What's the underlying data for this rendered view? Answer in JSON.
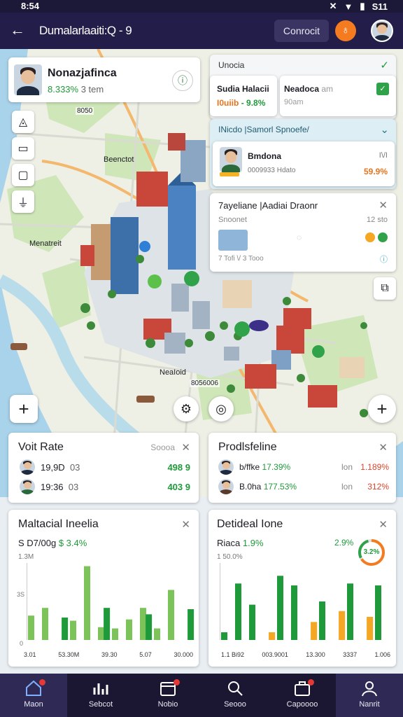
{
  "status": {
    "time": "8:54",
    "battery": "S11"
  },
  "appbar": {
    "title": "Dumalarlaaiti:Q - 9",
    "connect_label": "Conrocit"
  },
  "profile_card": {
    "name": "Nonazjafinca",
    "percent": "8.333%",
    "sub": "3 tem"
  },
  "right_panel": {
    "header": "Unocia",
    "card1": {
      "title": "Sudia Halacii",
      "val1": "I0uiib",
      "val2": "- 9.8%"
    },
    "card2": {
      "title": "Neadoca",
      "sub1": "am",
      "sub2": "90am"
    },
    "section2_header": "INicdo |Samorl Spnoefe/",
    "person": {
      "name": "Bmdona",
      "id": "0009933",
      "extra": "Hdato",
      "right_top": "I\\/I",
      "right_val": "59.9%"
    },
    "detail": {
      "title": "7ayeliane |Aadiai Draonr",
      "sub": "Snoonet",
      "right": "12 sto",
      "row": "7 Tofi \\/ 3 Tooo"
    }
  },
  "map_labels": {
    "l1": "8050",
    "l2": "Beenctot",
    "l3": "Menatreit",
    "l4": "NeaIoid",
    "l5": "8056006"
  },
  "card_rate": {
    "title": "Voit Rate",
    "badge": "Soooa",
    "rows": [
      {
        "v1": "19,9D",
        "v2": "03",
        "v3": "498 9"
      },
      {
        "v1": "19:36",
        "v2": "03",
        "v3": "403 9"
      }
    ]
  },
  "card_profit": {
    "title": "Prodlsfeline",
    "rows": [
      {
        "name": "b/ffke",
        "pct": "17.39%",
        "mid": "lon",
        "val": "1.189%"
      },
      {
        "name": "B.0ha",
        "pct": "177.53%",
        "mid": "lon",
        "val": "312%"
      }
    ]
  },
  "chart_left": {
    "title": "Maltacial Ineelia",
    "subtitle_a": "S D7/00g",
    "subtitle_b": "$ 3.4%",
    "subtitle_c": "1.3M",
    "y_labels": [
      "3S",
      "0"
    ],
    "x_labels": [
      "3.01",
      "53.30M",
      "39.30",
      "5.07",
      "30.000"
    ]
  },
  "chart_right": {
    "title": "Detideal Ione",
    "subtitle_a": "Riaca",
    "subtitle_b": "1.9%",
    "subtitle_c": "1 50.0%",
    "ring_value": "2.9%",
    "ring_label": "3.2%",
    "x_labels": [
      "1.1 Bi92",
      "003.9001",
      "13.300",
      "3337",
      "1.006"
    ]
  },
  "chart_data": [
    {
      "type": "bar",
      "series": [
        {
          "values": [
            38,
            50,
            0,
            30,
            115,
            20,
            18,
            32,
            50,
            18,
            78,
            0
          ]
        },
        {
          "values": [
            0,
            0,
            35,
            0,
            0,
            50,
            0,
            0,
            40,
            0,
            0,
            48
          ]
        },
        {
          "values": [
            0,
            0,
            0,
            0,
            0,
            0,
            0,
            0,
            0,
            0,
            0,
            0
          ]
        }
      ]
    },
    {
      "type": "bar",
      "series": [
        {
          "values": [
            12,
            88,
            55,
            0,
            100,
            85,
            0,
            60,
            0,
            88,
            0,
            85
          ]
        },
        {
          "values": [
            0,
            0,
            0,
            12,
            0,
            0,
            28,
            0,
            45,
            0,
            36,
            0
          ]
        }
      ]
    }
  ],
  "nav": [
    {
      "label": "Maon",
      "icon": "home-icon"
    },
    {
      "label": "Sebcot",
      "icon": "chart-icon"
    },
    {
      "label": "Nobio",
      "icon": "calendar-icon"
    },
    {
      "label": "Seooo",
      "icon": "search-icon"
    },
    {
      "label": "Capoooo",
      "icon": "briefcase-icon"
    },
    {
      "label": "Nanrit",
      "icon": "profile-icon"
    }
  ],
  "colors": {
    "appbar": "#231d4a",
    "green": "#1f9a3a",
    "orange": "#f47b20",
    "nav": "#1b1733"
  }
}
